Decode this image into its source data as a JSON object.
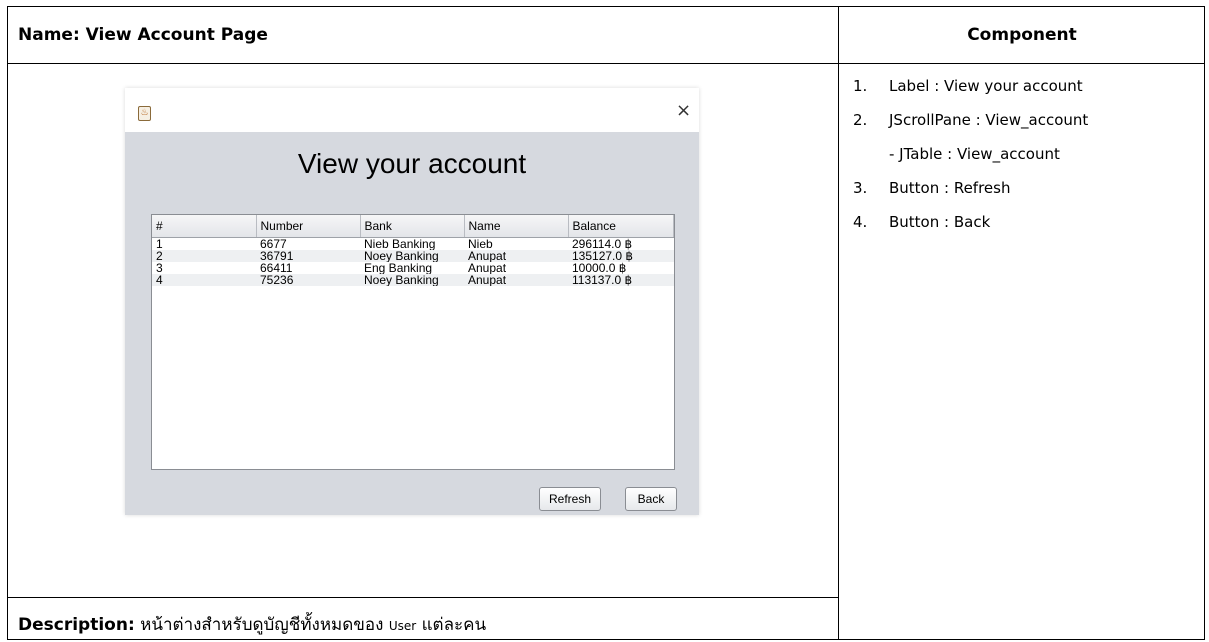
{
  "header": {
    "name_label": "Name: View Account Page",
    "component_label": "Component"
  },
  "description": {
    "label": "Description:",
    "text_prefix": " หน้าต่างสำหรับดูบัญชีทั้งหมดของ ",
    "text_user": "User",
    "text_suffix": " แต่ละคน"
  },
  "components": [
    {
      "num": "1.",
      "text": "Label : View your account"
    },
    {
      "num": "2.",
      "text": "JScrollPane : View_account"
    },
    {
      "sub": "- JTable : View_account"
    },
    {
      "num": "3.",
      "text": "Button : Refresh"
    },
    {
      "num": "4.",
      "text": "Button : Back"
    }
  ],
  "window": {
    "icon": "java-cup-icon",
    "close_glyph": "×",
    "title_label": "View your account",
    "table": {
      "columns": [
        "#",
        "Number",
        "Bank",
        "Name",
        "Balance"
      ],
      "rows": [
        [
          "1",
          "6677",
          "Nieb Banking",
          "Nieb",
          "296114.0 ฿"
        ],
        [
          "2",
          "36791",
          "Noey Banking",
          "Anupat",
          "135127.0 ฿"
        ],
        [
          "3",
          "66411",
          "Eng Banking",
          "Anupat",
          "10000.0 ฿"
        ],
        [
          "4",
          "75236",
          "Noey Banking",
          "Anupat",
          "113137.0 ฿"
        ]
      ]
    },
    "buttons": {
      "refresh": "Refresh",
      "back": "Back"
    }
  }
}
